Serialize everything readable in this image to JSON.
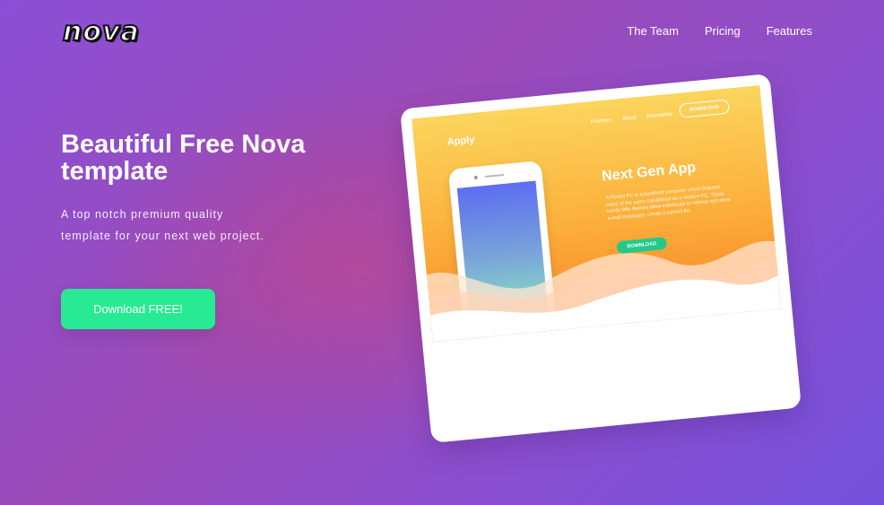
{
  "header": {
    "logo": "nova",
    "nav": [
      "The Team",
      "Pricing",
      "Features"
    ]
  },
  "hero": {
    "title": "Beautiful Free Nova template",
    "subtitle": "A top notch premium quality template for your next web project.",
    "cta_label": "Download FREE!"
  },
  "mockup": {
    "brand": "Apply",
    "nav": [
      "Features",
      "About",
      "Newsletter"
    ],
    "download_outline_label": "DOWNLOAD",
    "heading": "Next Gen App",
    "body_text": "A Pocket PC is a handheld computer, which features many of the same capabilities as a modern PC. These handy little devices allow individuals to retrieve and store e-mail messages, create a contact file.",
    "download_button_label": "DOWNLOAD"
  },
  "colors": {
    "accent_green": "#28ea95",
    "background_purple": "#8b4fd6",
    "mockup_orange": "#fcae3a"
  }
}
